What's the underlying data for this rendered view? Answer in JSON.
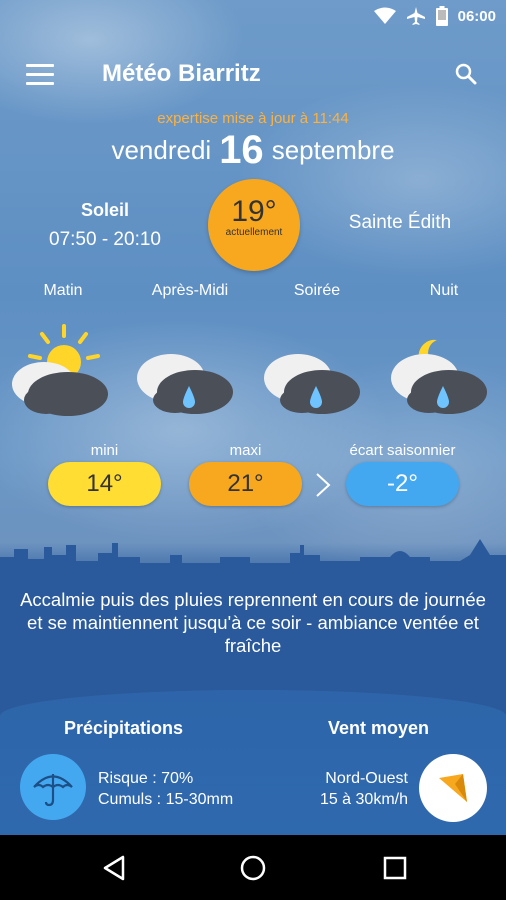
{
  "status_bar": {
    "time": "06:00",
    "icons": [
      "wifi-icon",
      "airplane-icon",
      "battery-icon"
    ]
  },
  "app_bar": {
    "title": "Météo Biarritz",
    "menu_icon": "menu-icon",
    "search_icon": "search-icon"
  },
  "update": {
    "text": "expertise mise à jour à 11:44",
    "color": "#ffb13b"
  },
  "date": {
    "weekday": "vendredi",
    "day": "16",
    "month": "septembre"
  },
  "sun": {
    "label": "Soleil",
    "times": "07:50 - 20:10"
  },
  "current": {
    "temperature": "19°",
    "caption": "actuellement",
    "color": "#f8a81e"
  },
  "saint": "Sainte Édith",
  "periods": [
    {
      "label": "Matin",
      "icon": "sun-cloud-rain-icon"
    },
    {
      "label": "Après-Midi",
      "icon": "cloud-rain-icon"
    },
    {
      "label": "Soirée",
      "icon": "cloud-rain-icon"
    },
    {
      "label": "Nuit",
      "icon": "moon-cloud-rain-icon"
    }
  ],
  "temps": {
    "mini_label": "mini",
    "mini_value": "14°",
    "maxi_label": "maxi",
    "maxi_value": "21°",
    "ecart_label": "écart saisonnier",
    "ecart_value": "-2°",
    "colors": {
      "mini": "#ffdd33",
      "maxi": "#f8a81e",
      "ecart": "#44a8f0"
    }
  },
  "summary": "Accalmie puis des pluies reprennent en cours de journée et se maintiennent jusqu'à ce soir - ambiance ventée et fraîche",
  "precipitations": {
    "title": "Précipitations",
    "risk": "Risque : 70%",
    "amounts": "Cumuls : 15-30mm",
    "icon": "umbrella-icon"
  },
  "wind": {
    "title": "Vent moyen",
    "direction": "Nord-Ouest",
    "speed": "15 à 30km/h",
    "icon": "wind-arrow-icon"
  },
  "nav": [
    "back-icon",
    "home-icon",
    "recents-icon"
  ]
}
